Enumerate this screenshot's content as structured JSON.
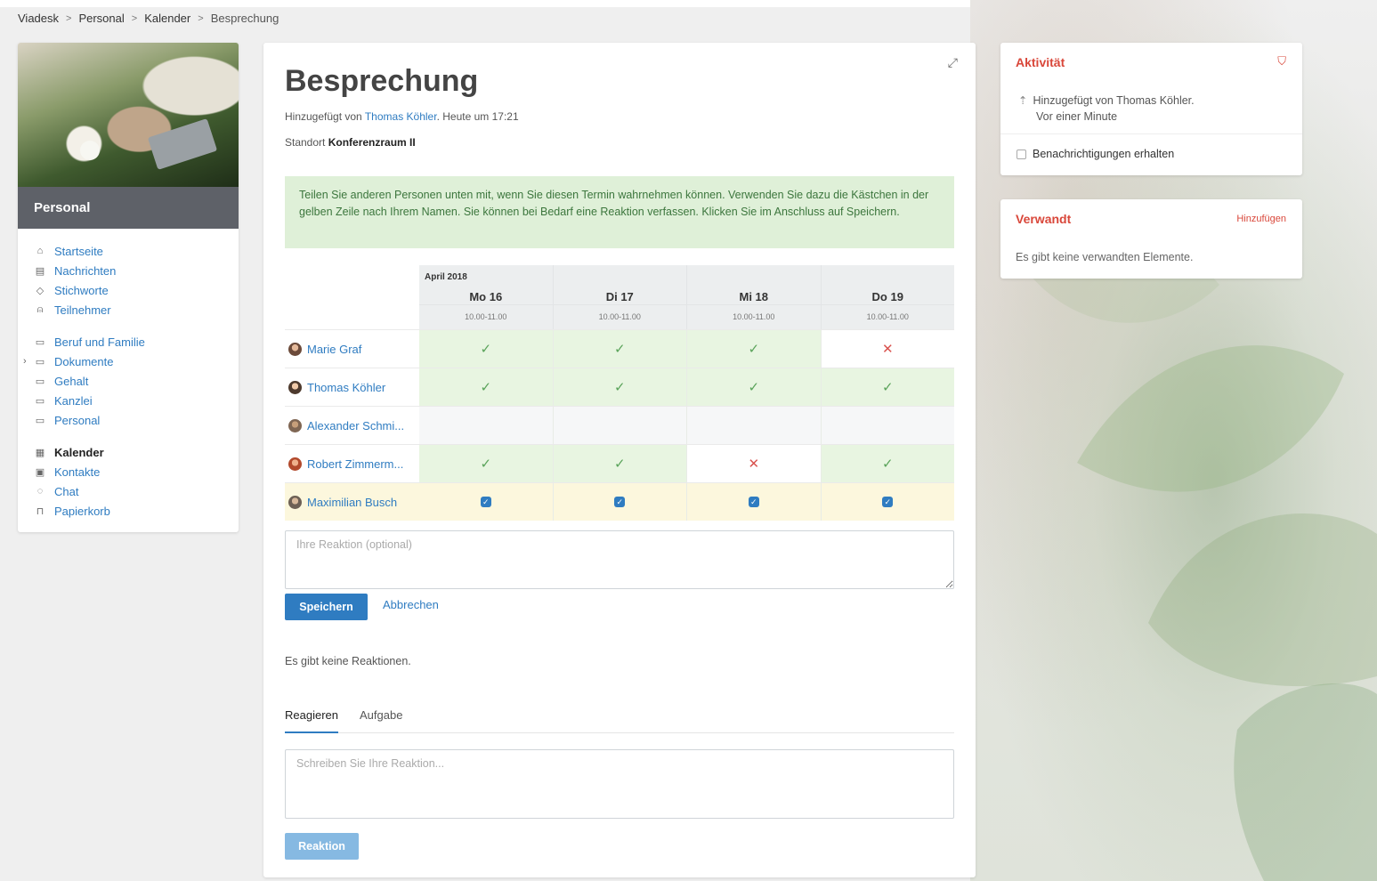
{
  "breadcrumb": [
    "Viadesk",
    "Personal",
    "Kalender",
    "Besprechung"
  ],
  "sidebar": {
    "title": "Personal",
    "groups": [
      [
        {
          "label": "Startseite",
          "icon": "home-icon"
        },
        {
          "label": "Nachrichten",
          "icon": "news-icon"
        },
        {
          "label": "Stichworte",
          "icon": "tag-icon"
        },
        {
          "label": "Teilnehmer",
          "icon": "user-icon"
        }
      ],
      [
        {
          "label": "Beruf und Familie",
          "icon": "folder-icon"
        },
        {
          "label": "Dokumente",
          "icon": "folder-icon"
        },
        {
          "label": "Gehalt",
          "icon": "folder-icon"
        },
        {
          "label": "Kanzlei",
          "icon": "folder-icon"
        },
        {
          "label": "Personal",
          "icon": "folder-icon"
        }
      ],
      [
        {
          "label": "Kalender",
          "icon": "calendar-icon"
        },
        {
          "label": "Kontakte",
          "icon": "contacts-icon"
        },
        {
          "label": "Chat",
          "icon": "chat-icon"
        },
        {
          "label": "Papierkorb",
          "icon": "trash-icon"
        }
      ]
    ]
  },
  "event": {
    "title": "Besprechung",
    "added_prefix": "Hinzugefügt von ",
    "added_by": "Thomas Köhler",
    "added_suffix": ". Heute um 17:21",
    "location_label": "Standort ",
    "location": "Konferenzraum II",
    "info": "Teilen Sie anderen Personen unten mit, wenn Sie diesen Termin wahrnehmen können. Verwenden Sie dazu die Kästchen in der gelben Zeile nach Ihrem Namen. Sie können bei Bedarf eine Reaktion verfassen. Klicken Sie im Anschluss auf Speichern."
  },
  "schedule": {
    "month": "April 2018",
    "days": [
      {
        "name": "Mo 16",
        "time": "10.00-11.00"
      },
      {
        "name": "Di 17",
        "time": "10.00-11.00"
      },
      {
        "name": "Mi 18",
        "time": "10.00-11.00"
      },
      {
        "name": "Do 19",
        "time": "10.00-11.00"
      }
    ],
    "rows": [
      {
        "name": "Marie Graf",
        "answers": [
          "yes",
          "yes",
          "yes",
          "no"
        ]
      },
      {
        "name": "Thomas Köhler",
        "answers": [
          "yes",
          "yes",
          "yes",
          "yes"
        ]
      },
      {
        "name": "Alexander Schmi...",
        "answers": [
          "none",
          "none",
          "none",
          "none"
        ]
      },
      {
        "name": "Robert Zimmerm...",
        "answers": [
          "yes",
          "yes",
          "no",
          "yes"
        ]
      },
      {
        "name": "Maximilian Busch",
        "answers": [
          "checked",
          "checked",
          "checked",
          "checked"
        ]
      }
    ]
  },
  "reaction_form": {
    "placeholder": "Ihre Reaktion (optional)",
    "save_label": "Speichern",
    "cancel_label": "Abbrechen"
  },
  "reactions": {
    "empty_text": "Es gibt keine Reaktionen.",
    "tabs": [
      "Reagieren",
      "Aufgabe"
    ],
    "comment_placeholder": "Schreiben Sie Ihre Reaktion...",
    "submit_label": "Reaktion"
  },
  "activity": {
    "title": "Aktivität",
    "entry_line1": "Hinzugefügt von Thomas Köhler.",
    "entry_line2": "Vor einer Minute",
    "notify_label": "Benachrichtigungen erhalten"
  },
  "related": {
    "title": "Verwandt",
    "add_label": "Hinzufügen",
    "empty_text": "Es gibt keine verwandten Elemente."
  },
  "colors": {
    "accent": "#2f7cc1",
    "panel_title": "#d9473a",
    "yes": "#5aa35a",
    "no": "#d9534f",
    "info_bg": "#dff0d8"
  }
}
